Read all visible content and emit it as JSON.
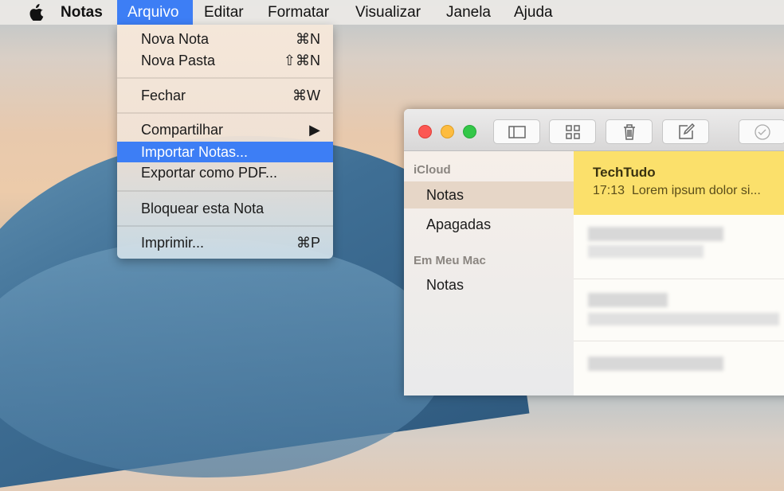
{
  "menubar": {
    "apple_icon": "apple-logo",
    "items": [
      "Notas",
      "Arquivo",
      "Editar",
      "Formatar",
      "Visualizar",
      "Janela",
      "Ajuda"
    ],
    "active": "Arquivo"
  },
  "file_menu": {
    "items": [
      {
        "label": "Nova Nota",
        "shortcut": "⌘N"
      },
      {
        "label": "Nova Pasta",
        "shortcut": "⇧⌘N"
      },
      {
        "label": "Fechar",
        "shortcut": "⌘W"
      },
      {
        "label": "Compartilhar",
        "shortcut": "▶"
      },
      {
        "label": "Importar Notas...",
        "shortcut": ""
      },
      {
        "label": "Exportar como PDF...",
        "shortcut": ""
      },
      {
        "label": "Bloquear esta Nota",
        "shortcut": ""
      },
      {
        "label": "Imprimir...",
        "shortcut": "⌘P"
      }
    ],
    "highlighted": "Importar Notas...",
    "highlight_color": "#3d7ef5"
  },
  "window": {
    "toolbar": [
      "sidebar-toggle-icon",
      "grid-view-icon",
      "trash-icon",
      "compose-icon",
      "checklist-icon"
    ],
    "sidebar": {
      "sections": [
        {
          "header": "iCloud",
          "items": [
            "Notas",
            "Apagadas"
          ]
        },
        {
          "header": "Em Meu Mac",
          "items": [
            "Notas"
          ]
        }
      ],
      "selected": "Notas"
    },
    "notes": [
      {
        "title": "TechTudo",
        "time": "17:13",
        "preview": "Lorem ipsum dolor si..."
      }
    ],
    "note_color": "#fbe06b"
  }
}
